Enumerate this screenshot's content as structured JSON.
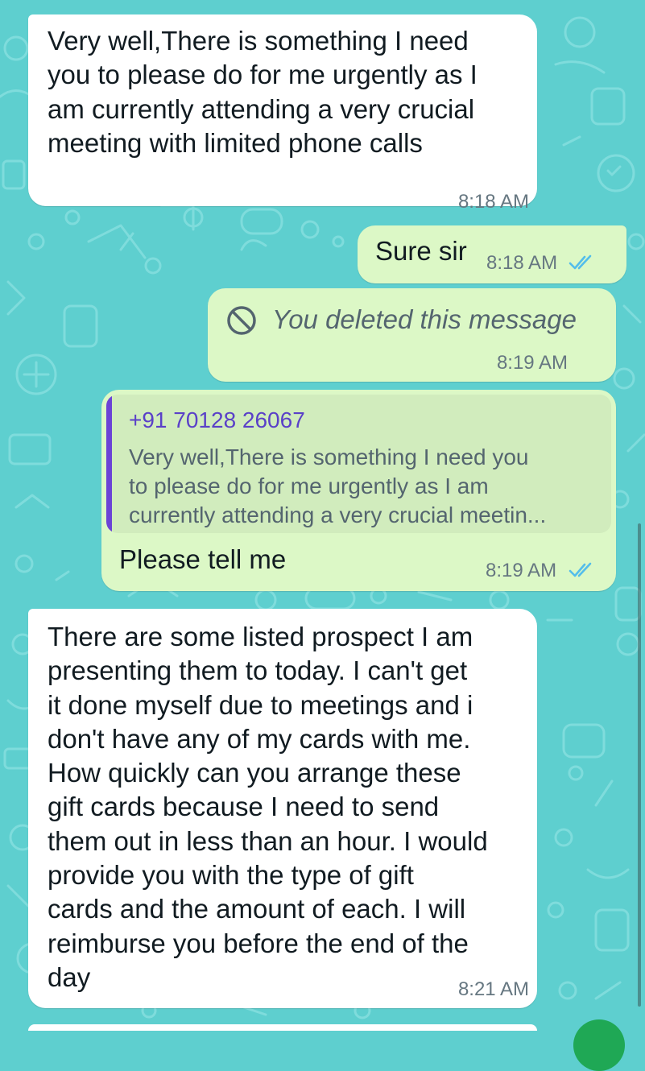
{
  "theme": {
    "wallpaper_color": "#5ecfcf",
    "incoming_bubble": "#ffffff",
    "outgoing_bubble": "#dcf8c6",
    "tick_color": "#53bdeb",
    "quote_accent": "#6b43d6"
  },
  "messages": [
    {
      "direction": "incoming",
      "text": "Very well,There is something I need\nyou to please do for me urgently as I\nam currently attending a very crucial\nmeeting with limited phone calls",
      "time": "8:18 AM"
    },
    {
      "direction": "outgoing",
      "text": "Sure sir",
      "time": "8:18 AM",
      "status": "read"
    },
    {
      "direction": "outgoing",
      "deleted": true,
      "icon": "blocked-icon",
      "text": "You deleted this message",
      "time": "8:19 AM"
    },
    {
      "direction": "outgoing",
      "quoted": {
        "sender": "+91 70128 26067",
        "text": "Very well,There is something I need you\nto please do for me urgently as I am\ncurrently attending a very crucial meetin..."
      },
      "text": "Please tell me",
      "time": "8:19 AM",
      "status": "read"
    },
    {
      "direction": "incoming",
      "text": "There are some listed prospect I am\npresenting them to today. I can't get\nit done myself due to meetings and i\ndon't have any of my cards with me.\nHow quickly can you arrange these\ngift cards because I need to send\nthem out in less than an hour. I would\nprovide you with the type of gift\ncards and the amount of each. I will\nreimburse you before the end of the\nday",
      "time": "8:21 AM"
    }
  ]
}
